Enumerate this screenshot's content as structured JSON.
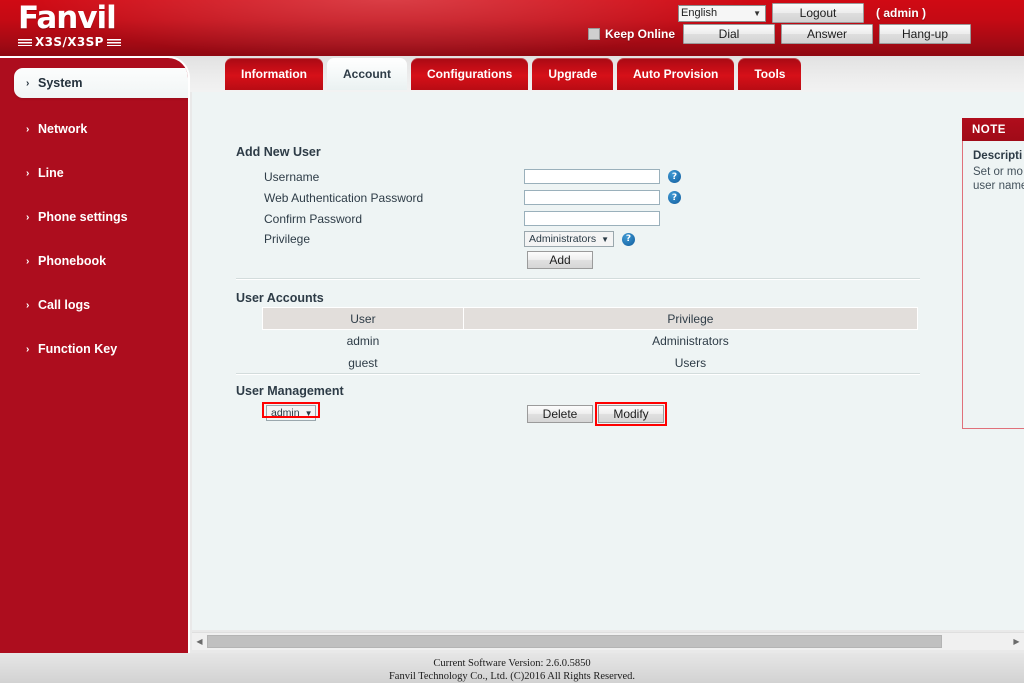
{
  "brand": {
    "name": "Fanvil",
    "model": "X3S/X3SP"
  },
  "header": {
    "language_value": "English",
    "logout_label": "Logout",
    "admin_label": "( admin )",
    "keep_online_label": "Keep Online",
    "dial_label": "Dial",
    "answer_label": "Answer",
    "hangup_label": "Hang-up"
  },
  "tabs": [
    {
      "label": "Information",
      "active": false
    },
    {
      "label": "Account",
      "active": true
    },
    {
      "label": "Configurations",
      "active": false
    },
    {
      "label": "Upgrade",
      "active": false
    },
    {
      "label": "Auto Provision",
      "active": false
    },
    {
      "label": "Tools",
      "active": false
    }
  ],
  "sidebar": {
    "items": [
      {
        "label": "System",
        "active": true
      },
      {
        "label": "Network",
        "active": false
      },
      {
        "label": "Line",
        "active": false
      },
      {
        "label": "Phone settings",
        "active": false
      },
      {
        "label": "Phonebook",
        "active": false
      },
      {
        "label": "Call logs",
        "active": false
      },
      {
        "label": "Function Key",
        "active": false
      }
    ]
  },
  "main": {
    "add_new_user": {
      "title": "Add New User",
      "username_label": "Username",
      "username_value": "",
      "web_auth_password_label": "Web Authentication Password",
      "web_auth_password_value": "",
      "confirm_password_label": "Confirm Password",
      "confirm_password_value": "",
      "privilege_label": "Privilege",
      "privilege_value": "Administrators",
      "add_label": "Add",
      "help_glyph": "?"
    },
    "user_accounts": {
      "title": "User Accounts",
      "columns": [
        "User",
        "Privilege"
      ],
      "rows": [
        [
          "admin",
          "Administrators"
        ],
        [
          "guest",
          "Users"
        ]
      ]
    },
    "user_management": {
      "title": "User Management",
      "selected_user": "admin",
      "delete_label": "Delete",
      "modify_label": "Modify"
    }
  },
  "note": {
    "header": "NOTE",
    "title": "Descripti",
    "text": "Set or mo\nuser name"
  },
  "footer": {
    "version_line": "Current Software Version: 2.6.0.5850",
    "copyright_line": "Fanvil Technology Co., Ltd. (C)2016 All Rights Reserved."
  },
  "colors": {
    "brand_red": "#ad0d1e",
    "header_red_top": "#d00a14",
    "content_bg": "#eef4f4",
    "highlight_red": "#ff0000",
    "help_blue": "#1f6fae"
  }
}
